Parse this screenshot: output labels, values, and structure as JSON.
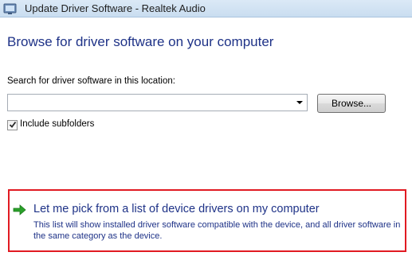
{
  "window": {
    "title": "Update Driver Software - Realtek Audio",
    "icon": "device-window-icon"
  },
  "page": {
    "heading": "Browse for driver software on your computer"
  },
  "search": {
    "label": "Search for driver software in this location:",
    "value": "",
    "browse_label": "Browse..."
  },
  "options": {
    "include_subfolders_label": "Include subfolders",
    "include_subfolders_checked": true
  },
  "pick_option": {
    "title": "Let me pick from a list of device drivers on my computer",
    "description": "This list will show installed driver software compatible with the device, and all driver software in the same category as the device.",
    "icon": "green-arrow-icon",
    "highlight_color": "#e11a22"
  },
  "colors": {
    "heading": "#1e3287",
    "arrow": "#2aa12a"
  }
}
